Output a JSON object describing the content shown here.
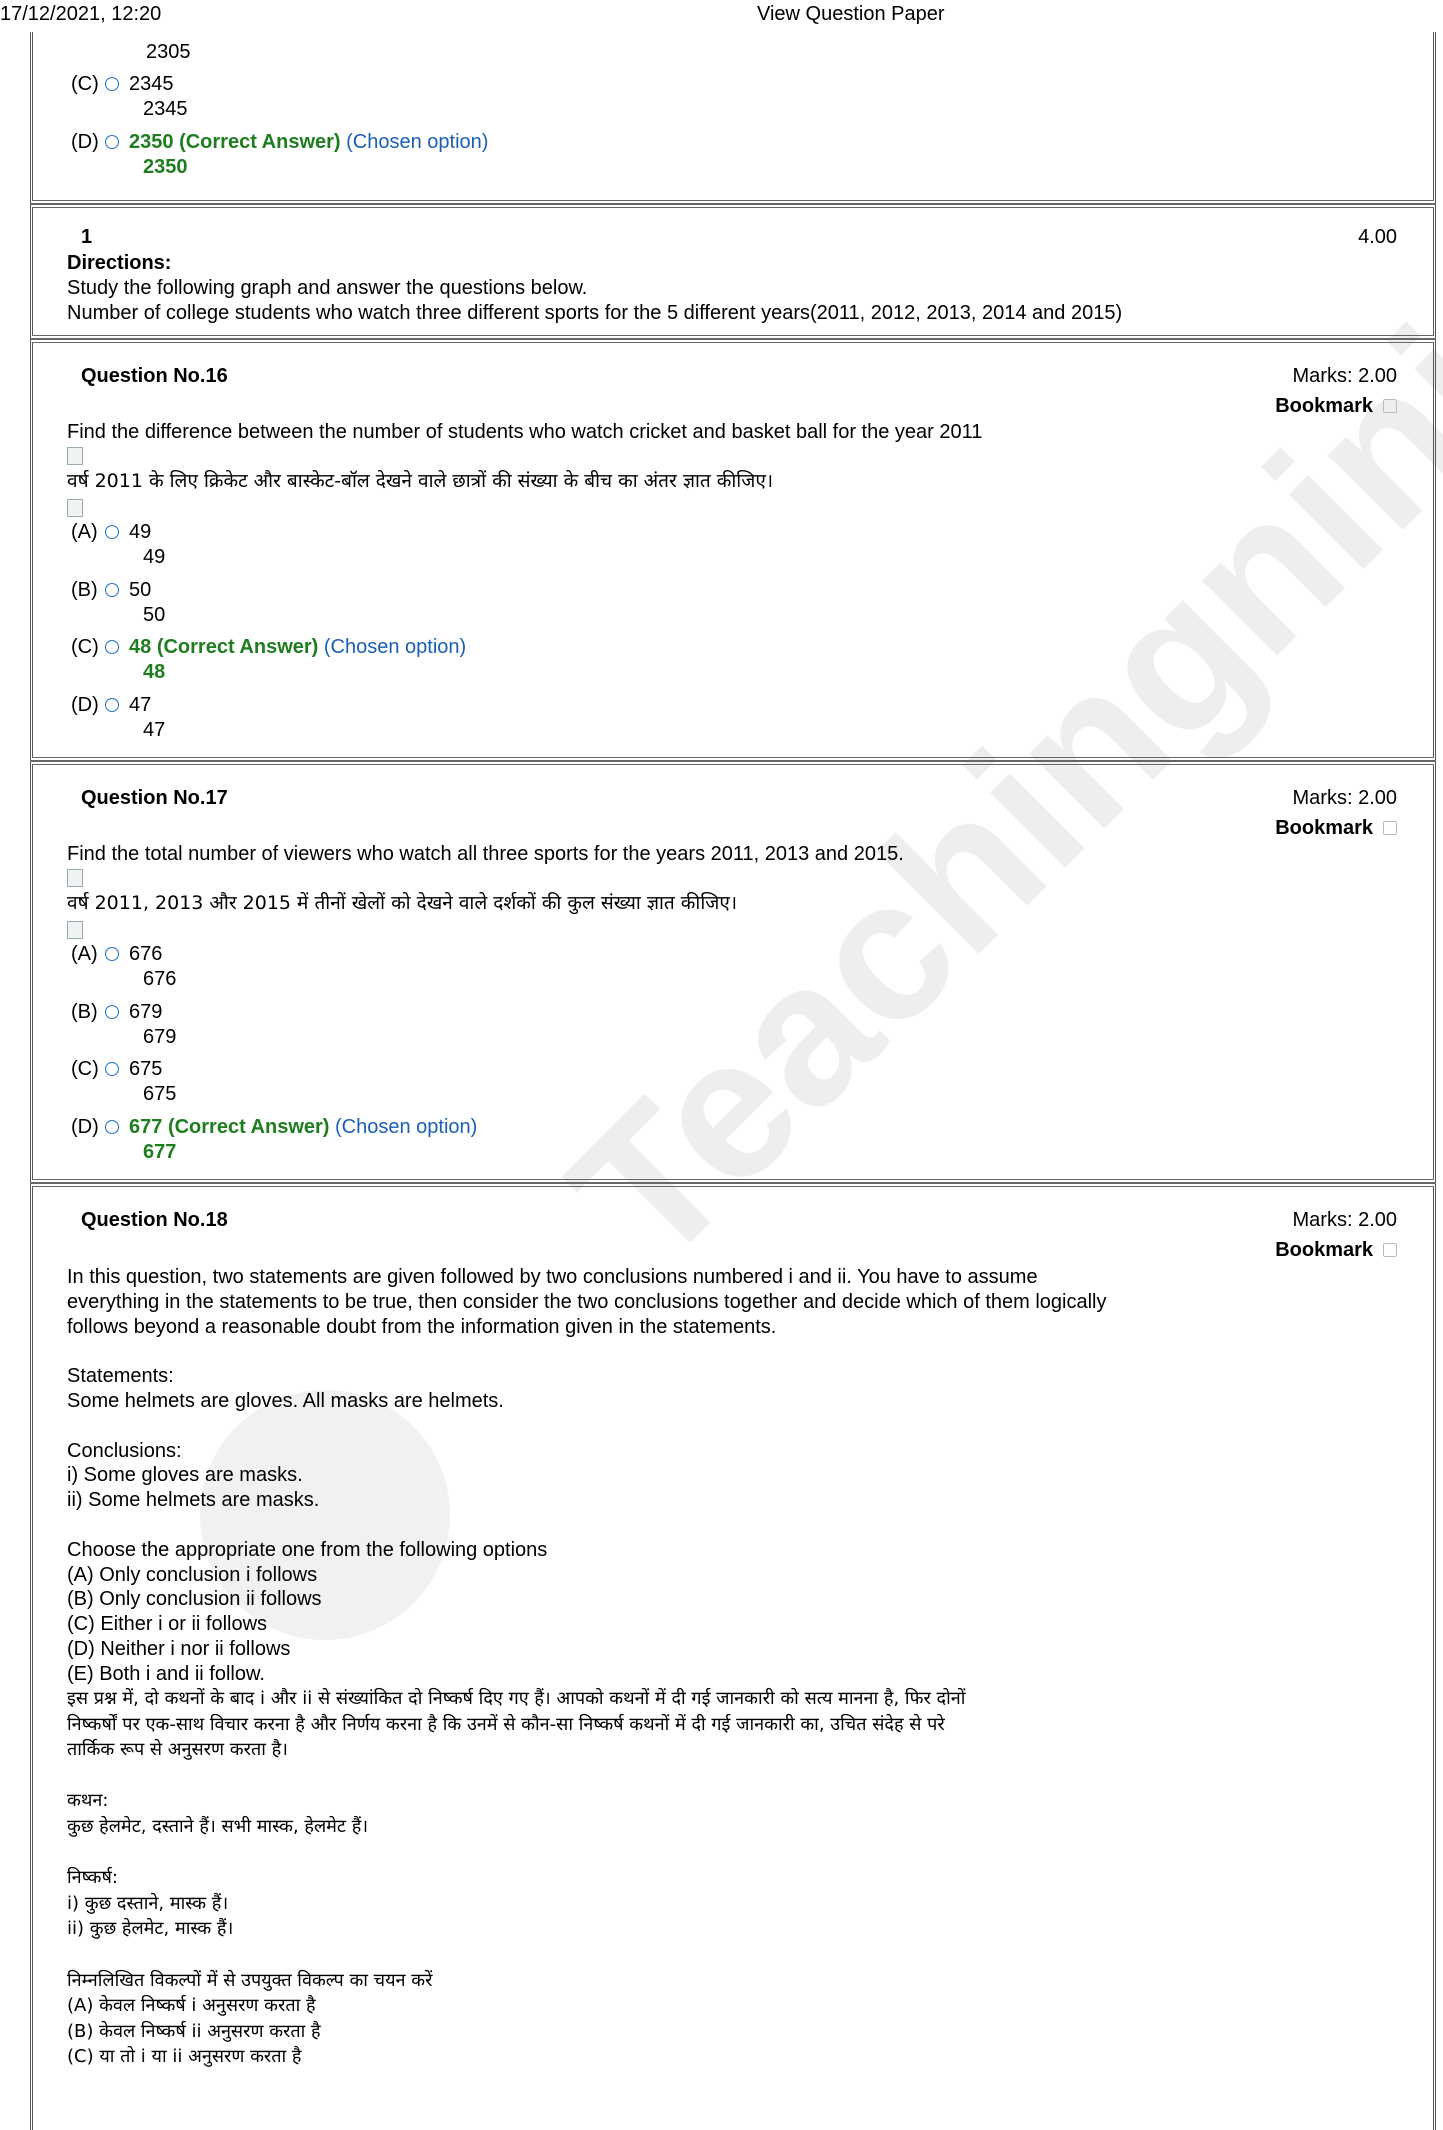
{
  "header": {
    "timestamp": "17/12/2021, 12:20",
    "title": "View Question Paper"
  },
  "prev": {
    "line_top": "2305",
    "options": [
      {
        "label": "(C)",
        "v1": "2345",
        "v2": "2345",
        "correct": false,
        "chosen": false
      },
      {
        "label": "(D)",
        "v1": "2350",
        "v2": "2350",
        "correct": true,
        "chosen": true
      }
    ]
  },
  "common": {
    "correct_tag": "(Correct Answer)",
    "chosen_tag": "(Chosen option)",
    "bookmark_label": "Bookmark"
  },
  "section": {
    "number": "1",
    "marks": "4.00",
    "directions_label": "Directions:",
    "line1": "Study the following graph and answer the questions below.",
    "line2": "Number of college students who watch three different sports for the 5 different years(2011, 2012, 2013, 2014 and 2015)"
  },
  "questions": [
    {
      "title": "Question No.16",
      "marks": "Marks: 2.00",
      "en": "Find the difference between the number of students who watch cricket and basket ball for the year 2011",
      "hi": "वर्ष 2011 के लिए क्रिकेट और बास्केट-बॉल देखने वाले छात्रों की संख्या के बीच का अंतर ज्ञात कीजिए।",
      "options": [
        {
          "label": "(A)",
          "v1": "49",
          "v2": "49",
          "correct": false,
          "chosen": false
        },
        {
          "label": "(B)",
          "v1": "50",
          "v2": "50",
          "correct": false,
          "chosen": false
        },
        {
          "label": "(C)",
          "v1": "48",
          "v2": "48",
          "correct": true,
          "chosen": true
        },
        {
          "label": "(D)",
          "v1": "47",
          "v2": "47",
          "correct": false,
          "chosen": false
        }
      ]
    },
    {
      "title": "Question No.17",
      "marks": "Marks: 2.00",
      "en": "Find the total number of viewers who watch all three sports for the years 2011, 2013 and 2015.",
      "hi": "वर्ष 2011, 2013 और 2015 में तीनों खेलों को देखने वाले दर्शकों की कुल संख्या ज्ञात कीजिए।",
      "options": [
        {
          "label": "(A)",
          "v1": "676",
          "v2": "676",
          "correct": false,
          "chosen": false
        },
        {
          "label": "(B)",
          "v1": "679",
          "v2": "679",
          "correct": false,
          "chosen": false
        },
        {
          "label": "(C)",
          "v1": "675",
          "v2": "675",
          "correct": false,
          "chosen": false
        },
        {
          "label": "(D)",
          "v1": "677",
          "v2": "677",
          "correct": true,
          "chosen": true
        }
      ]
    },
    {
      "title": "Question No.18",
      "marks": "Marks: 2.00",
      "en_lines": [
        "In this question, two statements are given followed by two conclusions numbered i and ii. You have to assume",
        "everything in the statements to be true, then consider the two conclusions together and decide which of them logically",
        "follows beyond a reasonable doubt from the information given in the statements.",
        "",
        "Statements:",
        "Some helmets are gloves. All masks are helmets.",
        "",
        "Conclusions:",
        "i) Some gloves are masks.",
        "ii) Some helmets are masks.",
        "",
        "Choose the appropriate one from the following options",
        "(A) Only conclusion i follows",
        "(B) Only conclusion ii follows",
        "(C) Either i or ii follows",
        "(D) Neither i nor ii follows",
        "(E) Both i and ii follow."
      ],
      "hi_lines": [
        "इस प्रश्न में, दो कथनों के बाद i और ii से संख्यांकित दो निष्कर्ष दिए गए हैं। आपको कथनों में दी गई जानकारी को सत्य मानना है, फिर दोनों",
        "निष्कर्षों पर एक-साथ विचार करना है और निर्णय करना है कि उनमें से कौन-सा निष्कर्ष कथनों में दी गई जानकारी का, उचित संदेह से परे",
        "तार्किक रूप से अनुसरण करता है।",
        "",
        "कथन:",
        "कुछ हेलमेट, दस्ताने हैं। सभी मास्क, हेलमेट हैं।",
        "",
        "निष्कर्ष:",
        "i) कुछ दस्ताने, मास्क हैं।",
        "ii) कुछ हेलमेट, मास्क हैं।",
        "",
        "निम्नलिखित विकल्पों में से उपयुक्त विकल्प का चयन करें",
        "(A) केवल निष्कर्ष i अनुसरण करता है",
        "(B) केवल निष्कर्ष ii अनुसरण करता है",
        "(C) या तो i या ii अनुसरण करता है"
      ]
    }
  ],
  "watermark": "Teachingninja.in"
}
